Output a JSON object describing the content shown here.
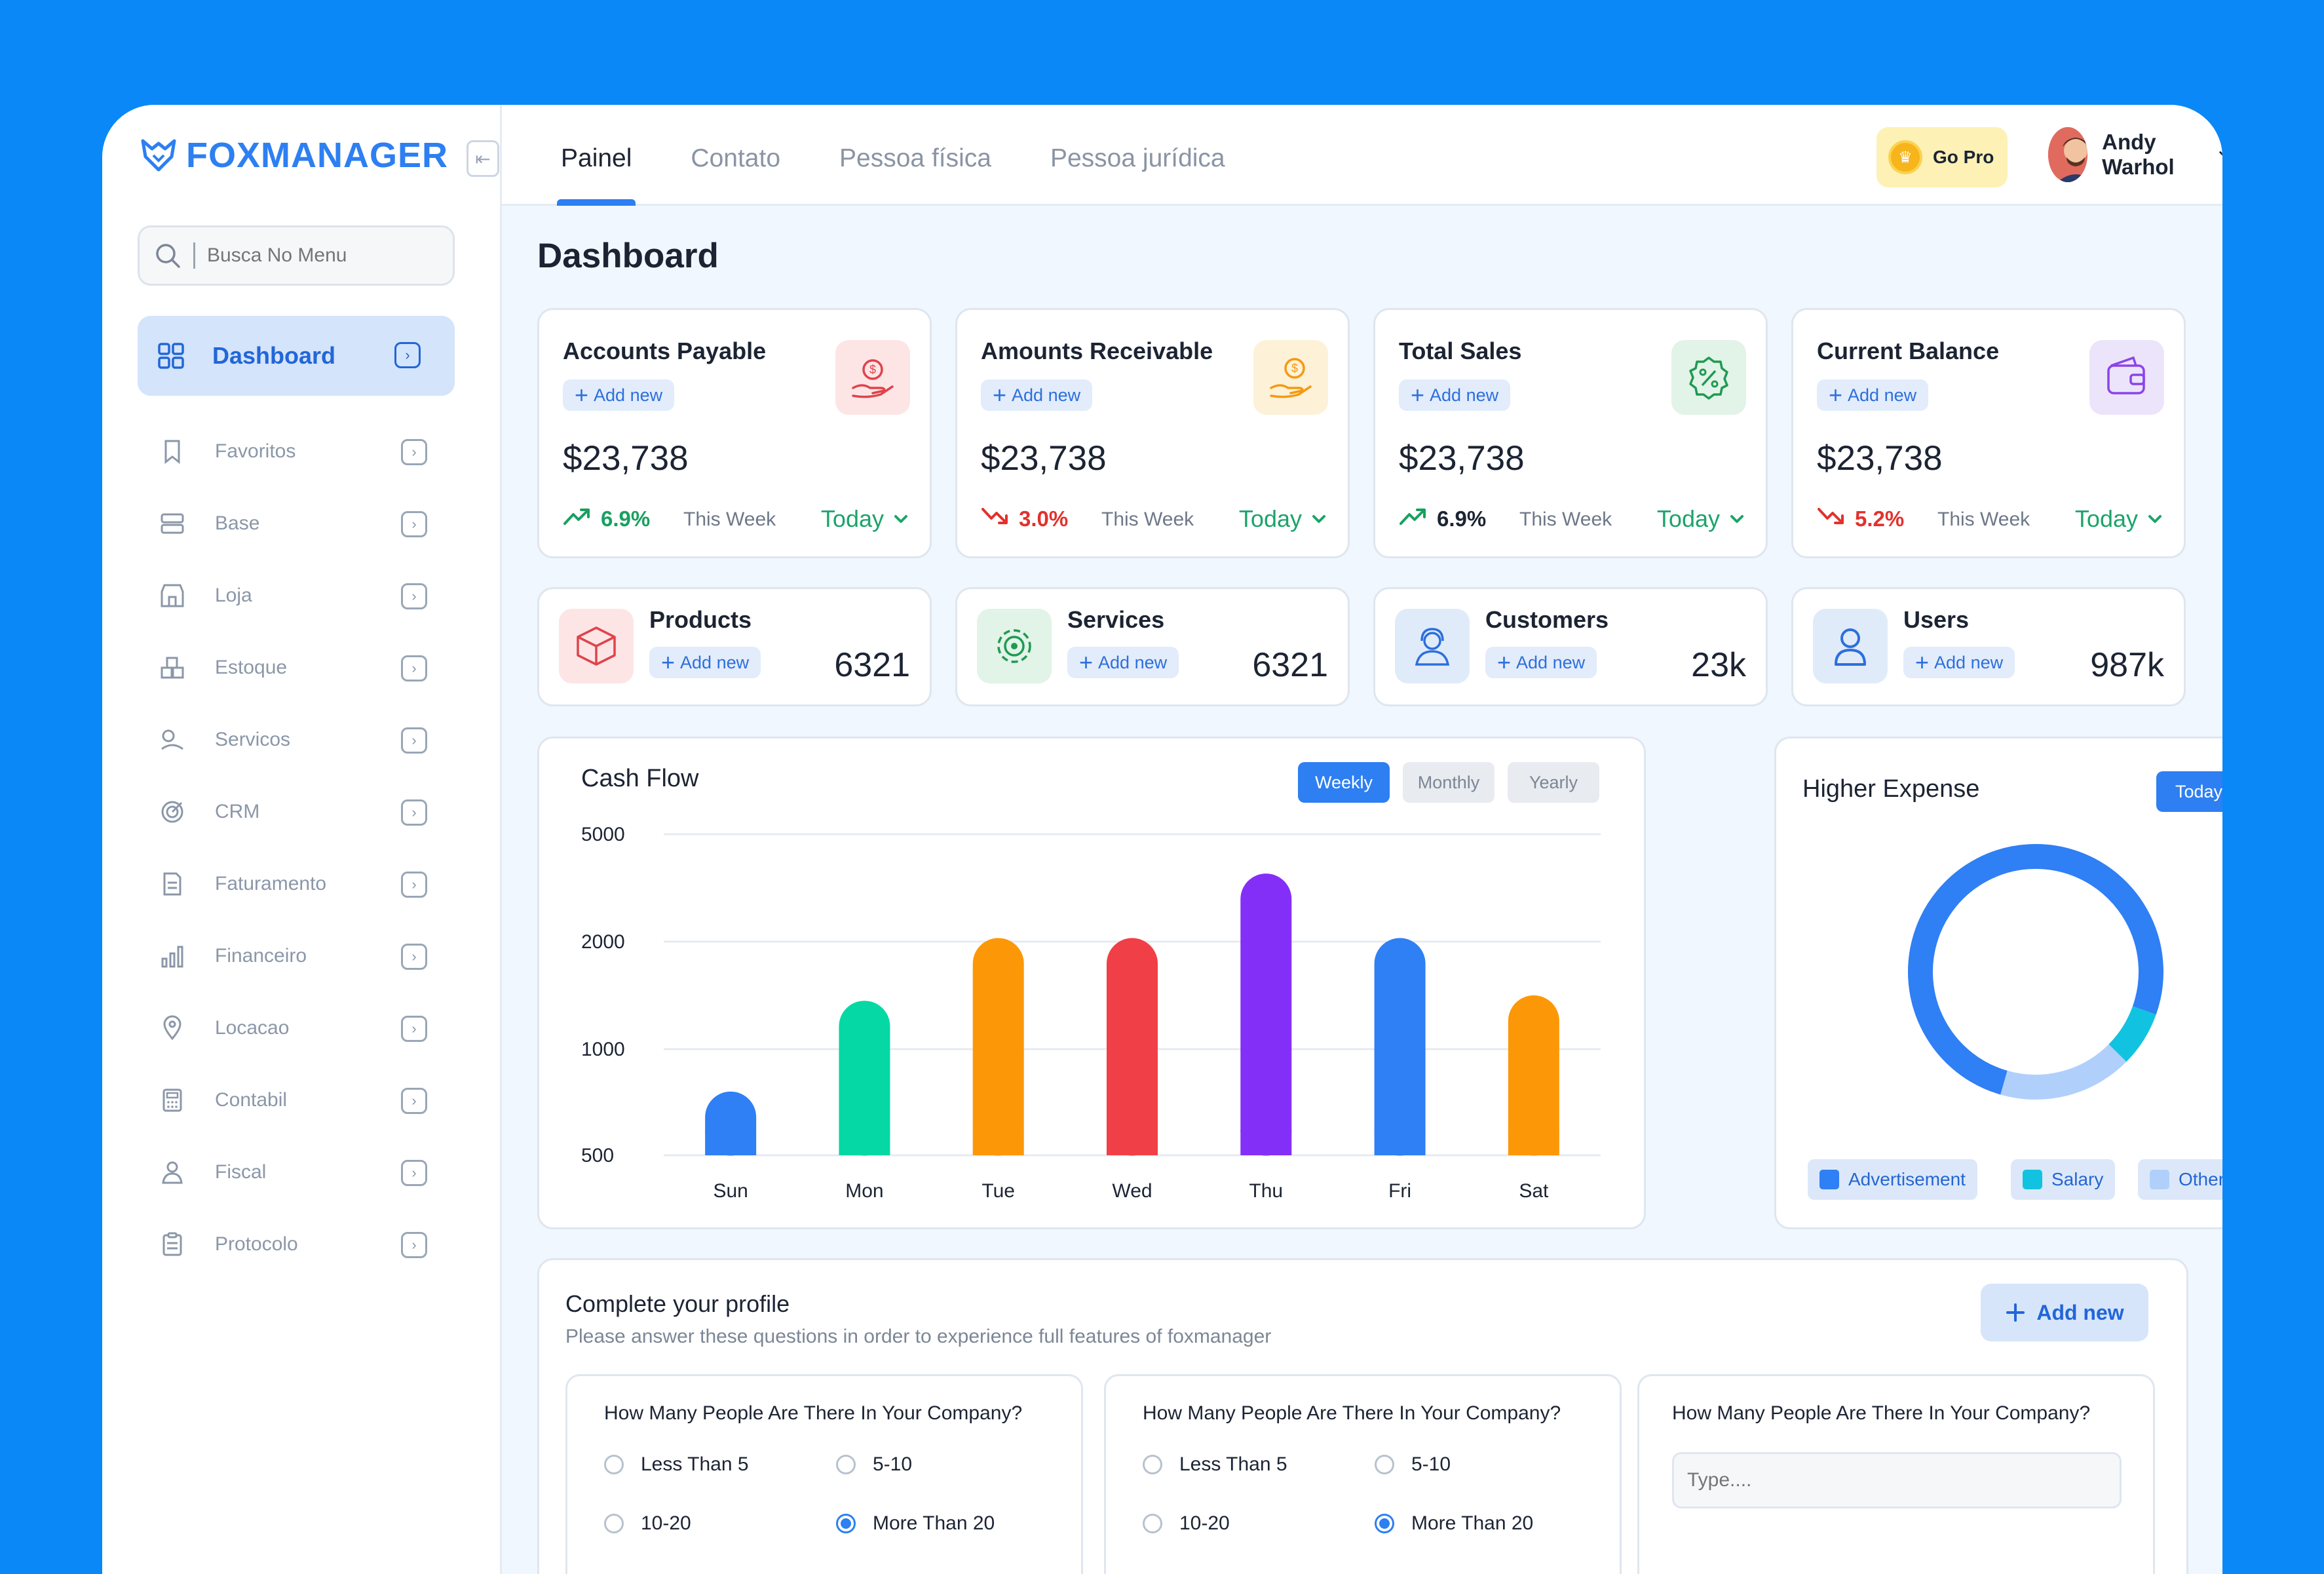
{
  "brand": {
    "name": "FOXMANAGER"
  },
  "sidebar": {
    "search_placeholder": "Busca No Menu",
    "active": {
      "label": "Dashboard",
      "icon": "grid-icon"
    },
    "items": [
      {
        "label": "Favoritos",
        "icon": "bookmark-icon"
      },
      {
        "label": "Base",
        "icon": "server-icon"
      },
      {
        "label": "Loja",
        "icon": "store-icon"
      },
      {
        "label": "Estoque",
        "icon": "boxes-icon"
      },
      {
        "label": "Servicos",
        "icon": "services-icon"
      },
      {
        "label": "CRM",
        "icon": "target-icon"
      },
      {
        "label": "Faturamento",
        "icon": "invoice-icon"
      },
      {
        "label": "Financeiro",
        "icon": "bar-chart-icon"
      },
      {
        "label": "Locacao",
        "icon": "location-pin-icon"
      },
      {
        "label": "Contabil",
        "icon": "calculator-icon"
      },
      {
        "label": "Fiscal",
        "icon": "inspector-icon"
      },
      {
        "label": "Protocolo",
        "icon": "clipboard-icon"
      }
    ]
  },
  "tabs": [
    {
      "label": "Painel",
      "active": true
    },
    {
      "label": "Contato"
    },
    {
      "label": "Pessoa física"
    },
    {
      "label": "Pessoa jurídica"
    }
  ],
  "header": {
    "go_pro": "Go Pro",
    "user_name": "Andy Warhol"
  },
  "page_title": "Dashboard",
  "kpis": [
    {
      "title": "Accounts Payable",
      "add": "Add new",
      "value": "$23,738",
      "change": "6.9%",
      "trend": "up",
      "period": "This Week",
      "range": "Today",
      "icon": "money-hand-icon",
      "icon_bg": "#fde5e6",
      "icon_color": "#e0434b",
      "change_color": "#18a05f"
    },
    {
      "title": "Amounts Receivable",
      "add": "Add new",
      "value": "$23,738",
      "change": "3.0%",
      "trend": "down",
      "period": "This Week",
      "range": "Today",
      "icon": "coin-hand-icon",
      "icon_bg": "#fdf1d8",
      "icon_color": "#f39a12",
      "change_color": "#e2312d"
    },
    {
      "title": "Total Sales",
      "add": "Add new",
      "value": "$23,738",
      "change": "6.9%",
      "trend": "up",
      "period": "This Week",
      "range": "Today",
      "icon": "discount-badge-icon",
      "icon_bg": "#e2f3e8",
      "icon_color": "#1f9a52",
      "change_color": "#1c2433"
    },
    {
      "title": "Current Balance",
      "add": "Add new",
      "value": "$23,738",
      "change": "5.2%",
      "trend": "down",
      "period": "This Week",
      "range": "Today",
      "icon": "wallet-icon",
      "icon_bg": "#ece4fb",
      "icon_color": "#8a45e8",
      "change_color": "#e2312d"
    }
  ],
  "counters": [
    {
      "title": "Products",
      "add": "Add new",
      "value": "6321",
      "icon": "box-icon",
      "icon_bg": "#fde5e6",
      "icon_color": "#e0434b"
    },
    {
      "title": "Services",
      "add": "Add new",
      "value": "6321",
      "icon": "gear-service-icon",
      "icon_bg": "#e2f3e8",
      "icon_color": "#1f9a52"
    },
    {
      "title": "Customers",
      "add": "Add new",
      "value": "23k",
      "icon": "support-agent-icon",
      "icon_bg": "#e0ebfa",
      "icon_color": "#2d6fdc"
    },
    {
      "title": "Users",
      "add": "Add new",
      "value": "987k",
      "icon": "user-icon",
      "icon_bg": "#e0ebfa",
      "icon_color": "#2d6fdc"
    }
  ],
  "cash_flow": {
    "title": "Cash Flow",
    "periods": [
      {
        "label": "Weekly",
        "active": true
      },
      {
        "label": "Monthly"
      },
      {
        "label": "Yearly"
      }
    ]
  },
  "higher_expense": {
    "title": "Higher Expense",
    "range": "Today"
  },
  "chart_data": [
    {
      "type": "bar",
      "title": "Cash Flow",
      "categories": [
        "Sun",
        "Mon",
        "Tue",
        "Wed",
        "Thu",
        "Fri",
        "Sat"
      ],
      "values": [
        800,
        1450,
        2100,
        2100,
        3900,
        2100,
        1500
      ],
      "colors": [
        "#2f7ff5",
        "#05d8a4",
        "#fc9807",
        "#f03f46",
        "#842ff7",
        "#2f7ff5",
        "#fc9807"
      ],
      "y_ticks": [
        "5000",
        "2000",
        "1000",
        "500"
      ],
      "grid": true
    },
    {
      "type": "pie",
      "title": "Higher Expense",
      "donut": true,
      "series": [
        {
          "name": "Advertisement",
          "value": 76,
          "color": "#2f7ff5"
        },
        {
          "name": "Salary",
          "value": 7,
          "color": "#11c3e0"
        },
        {
          "name": "Others",
          "value": 17,
          "color": "#b0d0fb"
        }
      ]
    }
  ],
  "profile": {
    "title": "Complete your profile",
    "subtitle": "Please answer these questions in order to experience full features of foxmanager",
    "add": "Add new",
    "questions": [
      {
        "q": "How Many People Are There In Your Company?",
        "options": [
          "Less Than 5",
          "5-10",
          "10-20",
          "More Than 20"
        ],
        "selected": 3
      },
      {
        "q": "How Many People Are There In Your Company?",
        "options": [
          "Less Than 5",
          "5-10",
          "10-20",
          "More Than 20"
        ],
        "selected": 3
      },
      {
        "q": "How Many People Are There In Your Company?",
        "input_placeholder": "Type...."
      }
    ]
  }
}
